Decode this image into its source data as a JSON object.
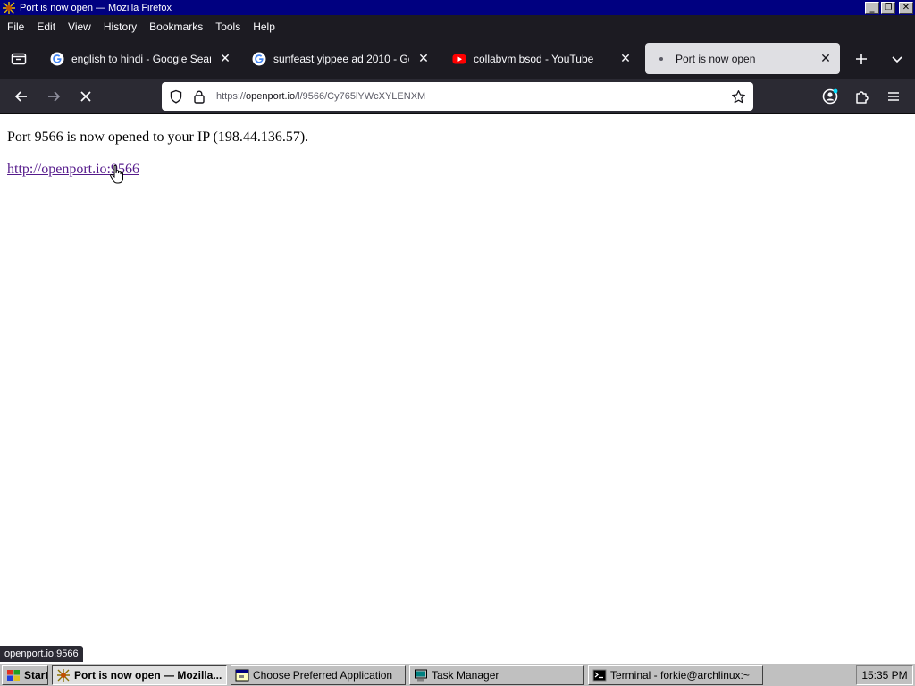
{
  "window": {
    "title": "Port is now open — Mozilla Firefox",
    "minimize_glyph": "_",
    "restore_glyph": "❐",
    "close_glyph": "✕"
  },
  "menu": [
    "File",
    "Edit",
    "View",
    "History",
    "Bookmarks",
    "Tools",
    "Help"
  ],
  "tabs": [
    {
      "title": "english to hindi - Google Search",
      "favicon": "google-icon"
    },
    {
      "title": "sunfeast yippee ad 2010 - Google S",
      "favicon": "google-icon"
    },
    {
      "title": "collabvm bsod - YouTube",
      "favicon": "youtube-icon"
    },
    {
      "title": "Port is now open",
      "favicon": "dot-icon",
      "active": true
    }
  ],
  "urlbar": {
    "prefix": "https://",
    "host": "openport.io",
    "path": "/l/9566/Cy765lYWcXYLENXM"
  },
  "page": {
    "message": "Port 9566 is now opened to your IP (198.44.136.57).",
    "link": "http://openport.io:9566"
  },
  "status_text": "openport.io:9566",
  "taskbar": {
    "start": "Start",
    "buttons": [
      {
        "label": "Port is now open — Mozilla...",
        "active": true
      },
      {
        "label": "Choose Preferred Application"
      },
      {
        "label": "Task Manager"
      },
      {
        "label": "Terminal - forkie@archlinux:~"
      }
    ],
    "clock": "15:35 PM"
  },
  "colors": {
    "titlebar": "#000080",
    "browser_chrome": "#1c1b22",
    "toolbar": "#2b2a33",
    "active_tab": "#dfdfe3",
    "visited_link": "#551a8b",
    "taskbar": "#c0c0c0"
  }
}
